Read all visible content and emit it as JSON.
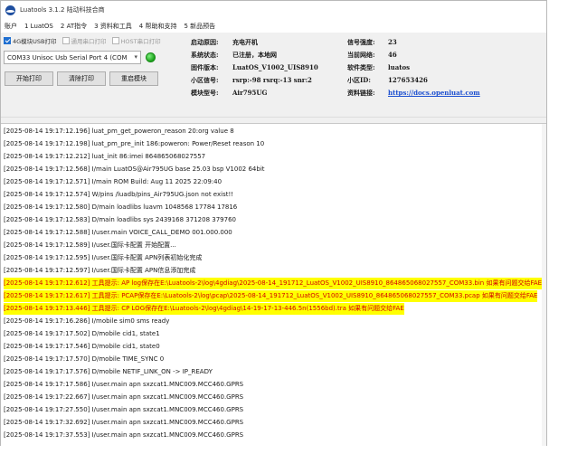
{
  "window": {
    "title": "Luatools 3.1.2 陆动科技合商"
  },
  "menu": [
    "账户",
    "1 LuatOS",
    "2 AT指令",
    "3 资料和工具",
    "4 帮助和支持",
    "5 新品预告"
  ],
  "checkboxes": [
    {
      "label": "4G模块USB打印",
      "checked": true,
      "disabled": false
    },
    {
      "label": "通用串口打印",
      "checked": false,
      "disabled": true
    },
    {
      "label": "HOST串口打印",
      "checked": false,
      "disabled": true
    }
  ],
  "port": {
    "selected": "COM33 Unisoc Usb Serial Port 4 (COM",
    "connected": true
  },
  "buttons": {
    "start_print": "开始打印",
    "clear_print": "清除打印",
    "restart_module": "重启模块"
  },
  "info": {
    "boot_reason_label": "启动原因:",
    "boot_reason": "充电开机",
    "sys_status_label": "系统状态:",
    "sys_status": "已注册，本地网",
    "firmware_label": "固件版本:",
    "firmware": "LuatOS_V1002_UIS8910",
    "cell_info_label": "小区信号:",
    "cell_info": "rsrp:-98 rsrq:-13 snr:2",
    "module_label": "模块型号:",
    "module": "Air795UG",
    "signal_label": "信号强度:",
    "signal": "23",
    "network_label": "当前网络:",
    "network": "46",
    "software_label": "软件类型:",
    "software": "luatos",
    "cell_id_label": "小区ID:",
    "cell_id": "127653426",
    "docs_label": "资料链接:",
    "docs": "https://docs.openluat.com"
  },
  "log": [
    {
      "text": "[2025-08-14 19:17:12.196] luat_pm_get_poweron_reason 20:org value 8",
      "hl": false
    },
    {
      "text": "[2025-08-14 19:17:12.198] luat_pm_pre_init 186:poweron: Power/Reset reason 10",
      "hl": false
    },
    {
      "text": "[2025-08-14 19:17:12.212] luat_init 86:imei 864865068027557",
      "hl": false
    },
    {
      "text": "[2025-08-14 19:17:12.568] I/main LuatOS@Air795UG base 25.03 bsp V1002 64bit",
      "hl": false
    },
    {
      "text": "[2025-08-14 19:17:12.571] I/main ROM Build: Aug 11 2025 22:09:40",
      "hl": false
    },
    {
      "text": "[2025-08-14 19:17:12.574] W/pins /luadb/pins_Air795UG.json not exist!!",
      "hl": false
    },
    {
      "text": "[2025-08-14 19:17:12.580] D/main loadlibs luavm 1048568 17784 17816",
      "hl": false
    },
    {
      "text": "[2025-08-14 19:17:12.583] D/main loadlibs sys   2439168 371208 379760",
      "hl": false
    },
    {
      "text": "[2025-08-14 19:17:12.588] I/user.main VOICE_CALL_DEMO 001.000.000",
      "hl": false
    },
    {
      "text": "[2025-08-14 19:17:12.589] I/user.国际卡配置 开始配置...",
      "hl": false
    },
    {
      "text": "[2025-08-14 19:17:12.595] I/user.国际卡配置 APN列表初始化完成",
      "hl": false
    },
    {
      "text": "[2025-08-14 19:17:12.597] I/user.国际卡配置 APN信息添加完成",
      "hl": false
    },
    {
      "text": "[2025-08-14 19:17:12.612] 工具提示: AP log保存在E:\\Luatools-2\\log\\4gdiag\\2025-08-14_191712_LuatOS_V1002_UIS8910_864865068027557_COM33.bin 如果有问题交给FAE",
      "hl": true
    },
    {
      "text": "[2025-08-14 19:17:12.617] 工具提示: PCAP保存在E:\\Luatools-2\\log\\pcap\\2025-08-14_191712_LuatOS_V1002_UIS8910_864865068027557_COM33.pcap 如果有问题交给FAE",
      "hl": true
    },
    {
      "text": "[2025-08-14 19:17:13.446] 工具提示: CP LOG保存在E:\\Luatools-2\\log\\4gdiag\\14-19-17-13-446.5n(1556bd).tra 如果有问题交给FAE",
      "hl": true
    },
    {
      "text": "[2025-08-14 19:17:16.286] I/mobile sim0 sms ready",
      "hl": false
    },
    {
      "text": "[2025-08-14 19:17:17.502] D/mobile cid1, state1",
      "hl": false
    },
    {
      "text": "[2025-08-14 19:17:17.546] D/mobile cid1, state0",
      "hl": false
    },
    {
      "text": "[2025-08-14 19:17:17.570] D/mobile TIME_SYNC 0",
      "hl": false
    },
    {
      "text": "[2025-08-14 19:17:17.576] D/mobile NETIF_LINK_ON -> IP_READY",
      "hl": false
    },
    {
      "text": "[2025-08-14 19:17:17.586] I/user.main  apn sxzcat1.MNC009.MCC460.GPRS",
      "hl": false
    },
    {
      "text": "[2025-08-14 19:17:22.667] I/user.main  apn sxzcat1.MNC009.MCC460.GPRS",
      "hl": false
    },
    {
      "text": "[2025-08-14 19:17:27.550] I/user.main  apn sxzcat1.MNC009.MCC460.GPRS",
      "hl": false
    },
    {
      "text": "[2025-08-14 19:17:32.692] I/user.main  apn sxzcat1.MNC009.MCC460.GPRS",
      "hl": false
    },
    {
      "text": "[2025-08-14 19:17:37.553] I/user.main  apn sxzcat1.MNC009.MCC460.GPRS",
      "hl": false
    }
  ],
  "colors": {
    "highlight_bg": "#ffff00",
    "highlight_text": "#d40000",
    "link": "#1c4fd0",
    "status_ok": "#1aa01a"
  }
}
